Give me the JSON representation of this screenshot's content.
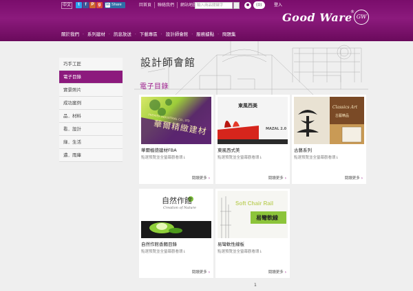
{
  "topbar": {
    "lang": "中文",
    "social": [
      {
        "name": "twitter-icon",
        "glyph": "t",
        "color": "#2aa3ef"
      },
      {
        "name": "facebook-icon",
        "glyph": "f",
        "color": "#3b5998"
      },
      {
        "name": "plurk-icon",
        "glyph": "P",
        "color": "#cf682f"
      },
      {
        "name": "google-plus-icon",
        "glyph": "g",
        "color": "#dd4b39"
      }
    ],
    "share_label": "Share",
    "linkedin": "in",
    "links": [
      "回首頁",
      "聯絡我們",
      "網站地圖"
    ],
    "search_placeholder": "輸入商品關鍵字",
    "cart_count": "(0)",
    "login": "登入"
  },
  "logo": {
    "text": "Good Ware",
    "reg": "®",
    "seal": "GW"
  },
  "nav": [
    "關於我們",
    "系列建材",
    "訊息放送",
    "下載專區",
    "設計師會館",
    "服務據點",
    "問題集"
  ],
  "page_title": "設計師會館",
  "section_title": "電子目錄",
  "sidebar": [
    {
      "label": "巧手工匠",
      "active": false
    },
    {
      "label": "電子目錄",
      "active": true
    },
    {
      "label": "實景照片",
      "active": false
    },
    {
      "label": "成功案例",
      "active": false
    },
    {
      "label": "品．材料",
      "active": false
    },
    {
      "label": "看．設計",
      "active": false
    },
    {
      "label": "綠．生活",
      "active": false
    },
    {
      "label": "邁．雨庫",
      "active": false
    }
  ],
  "cards": [
    {
      "name": "華爾植徳建材FBA",
      "desc": "點選預覽並全螢幕觀看環↓",
      "more": "閱讀更多",
      "thumb_text": "華爾精緻建材",
      "thumb_sub": "PREMIER INDUSTRIAL CO., LTD"
    },
    {
      "name": "東風西式美",
      "desc": "點選預覽並全螢幕觀看環↓",
      "more": "閱讀更多",
      "thumb_text": "東風西美",
      "thumb_sub": "MAZAL 2.0"
    },
    {
      "name": "古藝系列",
      "desc": "點選預覽並全螢幕觀看環↓",
      "more": "閱讀更多",
      "thumb_text": "Classics Art",
      "thumb_sub": "古藝精品"
    },
    {
      "name": "自然作館香麵目錄",
      "desc": "點選預覽並全螢幕觀看環↓",
      "more": "閱讀更多",
      "thumb_text": "自然作館",
      "thumb_sub": "Creation of Nature"
    },
    {
      "name": "易彎軟性線板",
      "desc": "點選預覽並全螢幕觀看環↓",
      "more": "閱讀更多",
      "thumb_text": "Soft Chair Rail",
      "thumb_sub": "易彎軟線"
    }
  ],
  "pagination": "1"
}
